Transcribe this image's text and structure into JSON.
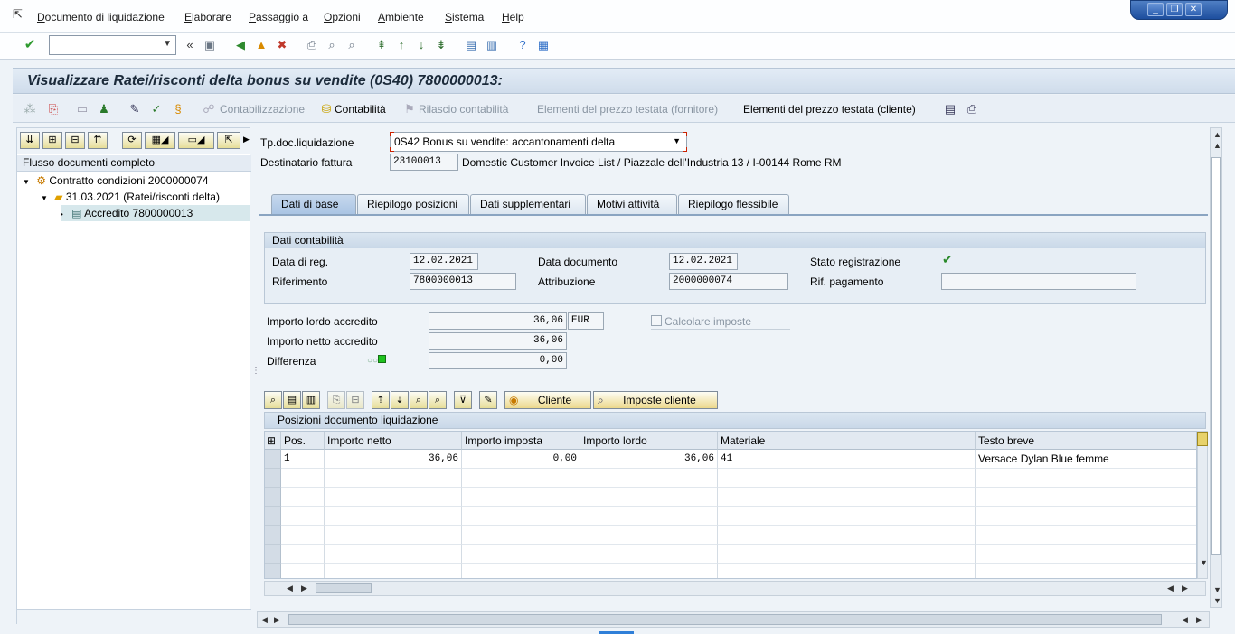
{
  "menu": {
    "items": [
      "Documento di liquidazione",
      "Elaborare",
      "Passaggio a",
      "Opzioni",
      "Ambiente",
      "Sistema",
      "Help"
    ]
  },
  "window": {
    "minimize": "_",
    "restore": "❐",
    "close": "✕"
  },
  "title": "Visualizzare Ratei/risconti delta bonus su vendite (0S40) 7800000013:",
  "app_toolbar": {
    "contabilizzazione": "Contabilizzazione",
    "contabilita": "Contabilità",
    "rilascio": "Rilascio contabilità",
    "elem_fornitore": "Elementi del prezzo testata (fornitore)",
    "elem_cliente": "Elementi del prezzo testata (cliente)"
  },
  "tree": {
    "header": "Flusso documenti completo",
    "nodes": [
      {
        "label": "Contratto condizioni 2000000074"
      },
      {
        "label": "31.03.2021 (Ratei/risconti delta)"
      },
      {
        "label": "Accredito 7800000013"
      }
    ]
  },
  "header": {
    "tpdoc_label": "Tp.doc.liquidazione",
    "tpdoc_value": "0S42 Bonus su vendite: accantonamenti delta",
    "dest_label": "Destinatario fattura",
    "dest_value": "23100013",
    "dest_text": "Domestic Customer Invoice List / Piazzale dell’Industria 13 / I-00144 Rome RM"
  },
  "tabs": [
    "Dati di base",
    "Riepilogo posizioni",
    "Dati supplementari",
    "Motivi attività",
    "Riepilogo flessibile"
  ],
  "contabilita": {
    "title": "Dati contabilità",
    "data_reg_label": "Data di reg.",
    "data_reg": "12.02.2021",
    "data_doc_label": "Data documento",
    "data_doc": "12.02.2021",
    "stato_label": "Stato registrazione",
    "rif_label": "Riferimento",
    "rif": "7800000013",
    "attr_label": "Attribuzione",
    "attr": "2000000074",
    "rifpag_label": "Rif. pagamento",
    "rifpag": ""
  },
  "importi": {
    "lordo_label": "Importo lordo accredito",
    "lordo": "36,06",
    "currency": "EUR",
    "netto_label": "Importo netto accredito",
    "netto": "36,06",
    "diff_label": "Differenza",
    "diff": "0,00",
    "calc_label": "Calcolare imposte"
  },
  "table_toolbar": {
    "cliente": "Cliente",
    "imposte": "Imposte cliente"
  },
  "table": {
    "title": "Posizioni documento liquidazione",
    "columns": [
      "Pos.",
      "Importo netto",
      "Importo imposta",
      "Importo lordo",
      "Materiale",
      "Testo breve"
    ],
    "rows": [
      {
        "pos": "1",
        "netto": "36,06",
        "imposta": "0,00",
        "lordo": "36,06",
        "materiale": "41",
        "testo": "Versace Dylan Blue femme"
      }
    ]
  }
}
